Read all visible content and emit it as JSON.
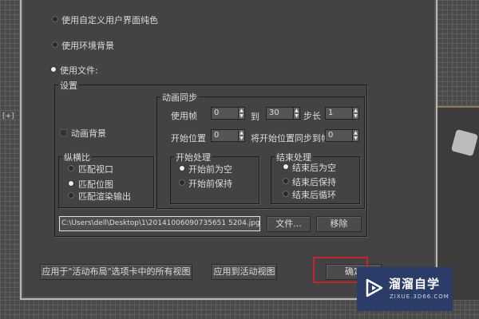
{
  "viewport_label": "[+]",
  "background_options": [
    {
      "label": "使用自定义用户界面纯色",
      "selected": false
    },
    {
      "label": "使用环境背景",
      "selected": false
    },
    {
      "label": "使用文件:",
      "selected": true
    }
  ],
  "settings": {
    "title": "设置",
    "animate_background": {
      "label": "动画背景",
      "checked": false
    },
    "aspect": {
      "title": "纵横比",
      "options": [
        {
          "label": "匹配视口",
          "selected": false
        },
        {
          "label": "匹配位图",
          "selected": true
        },
        {
          "label": "匹配渲染输出",
          "selected": false
        }
      ]
    },
    "anim_sync": {
      "title": "动画同步",
      "use_frame_label": "使用帧",
      "use_frame_from": "0",
      "to_label": "到",
      "use_frame_to": "30",
      "step_label": "步长",
      "step": "1",
      "start_pos_label": "开始位置",
      "start_pos": "0",
      "sync_label": "将开始位置同步到帧",
      "sync_frame": "0"
    },
    "start_processing": {
      "title": "开始处理",
      "options": [
        {
          "label": "开始前为空",
          "selected": true
        },
        {
          "label": "开始前保持",
          "selected": false
        }
      ]
    },
    "end_processing": {
      "title": "结束处理",
      "options": [
        {
          "label": "结束后为空",
          "selected": true
        },
        {
          "label": "结束后保持",
          "selected": false
        },
        {
          "label": "结束后循环",
          "selected": false
        }
      ]
    },
    "file_path": "C:\\Users\\dell\\Desktop\\1\\20141006090735651 5204.jpg",
    "file_button": "文件...",
    "remove_button": "移除"
  },
  "buttons": {
    "apply_all": "应用于\"活动布局\"选项卡中的所有视图",
    "apply_active": "应用到活动视图",
    "ok": "确定"
  },
  "watermark": {
    "name": "溜溜自学",
    "url": "ZIXUE.3D66.COM"
  }
}
